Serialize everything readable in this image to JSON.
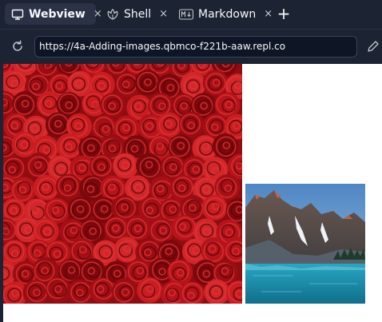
{
  "tabs": [
    {
      "label": "Webview",
      "icon": "monitor-icon",
      "active": true
    },
    {
      "label": "Shell",
      "icon": "shell-icon",
      "active": false
    },
    {
      "label": "Markdown",
      "icon": "markdown-icon",
      "active": false
    }
  ],
  "close_glyph": "×",
  "plus_glyph": "+",
  "markdown_badge": "M↓",
  "address": {
    "url": "https://4a-Adding-images.qbmco-f221b-aaw.repl.co"
  },
  "webview": {
    "images": [
      {
        "name": "red-roses-image",
        "subject": "red roses"
      },
      {
        "name": "mountain-lake-image",
        "subject": "mountain lake"
      }
    ]
  },
  "colors": {
    "chrome_bg": "#1c2333",
    "active_tab_bg": "#2b3245",
    "url_bg": "#0e1525",
    "text": "#f5f9fc"
  }
}
